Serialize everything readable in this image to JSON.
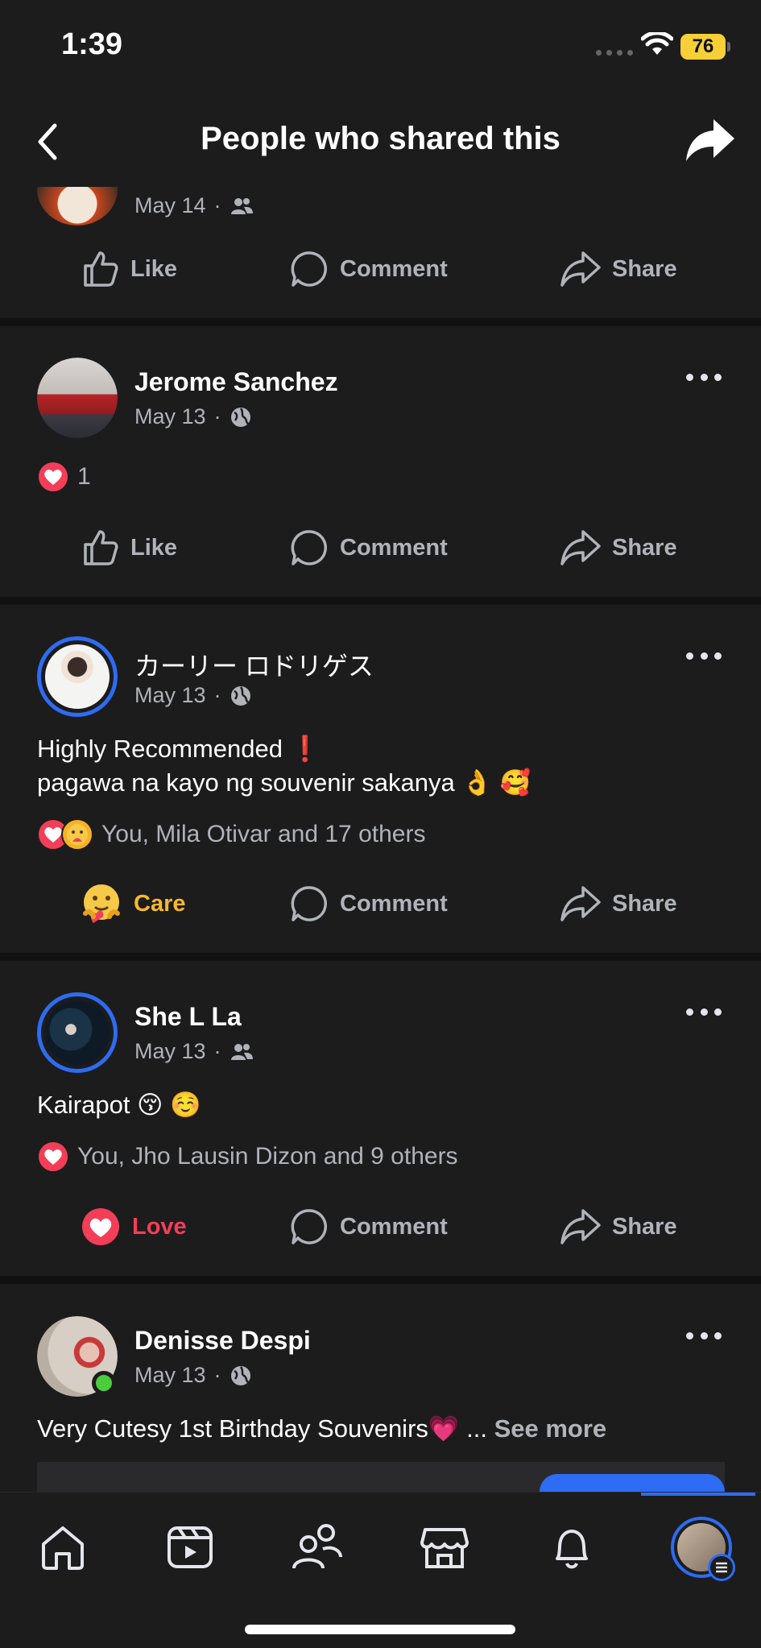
{
  "status_bar": {
    "time": "1:39",
    "battery": "76"
  },
  "header": {
    "title": "People who shared this"
  },
  "actions_labels": {
    "like": "Like",
    "comment": "Comment",
    "share": "Share",
    "care": "Care",
    "love": "Love"
  },
  "posts": [
    {
      "date": "May 14",
      "audience_icon": "friends-icon"
    },
    {
      "name": "Jerome Sanchez",
      "date": "May 13",
      "audience_icon": "globe-icon",
      "reaction_count": "1"
    },
    {
      "name": "カーリー ロドリゲス",
      "date": "May 13",
      "audience_icon": "globe-icon",
      "text_line1": "Highly Recommended  ❗",
      "text_line2": " pagawa na kayo ng souvenir sakanya 👌 🥰",
      "reaction_summary": "You, Mila Otivar and 17 others"
    },
    {
      "name": "She L La",
      "date": "May 13",
      "audience_icon": "friends-icon",
      "text_line1": "Kairapot 😚 ☺️",
      "reaction_summary": "You, Jho Lausin Dizon and 9 others"
    },
    {
      "name": "Denisse Despi",
      "date": "May 13",
      "audience_icon": "globe-icon",
      "text_line1": "Very Cutesy 1st Birthday Souvenirs💗 ...",
      "see_more": "See more"
    }
  ],
  "colors": {
    "accent": "#2d6cf3",
    "love": "#f33e58",
    "care": "#f7b928",
    "background": "#1c1c1d"
  },
  "tabbar": [
    "home-icon",
    "video-icon",
    "friends-icon",
    "marketplace-icon",
    "bell-icon",
    "profile-menu"
  ]
}
